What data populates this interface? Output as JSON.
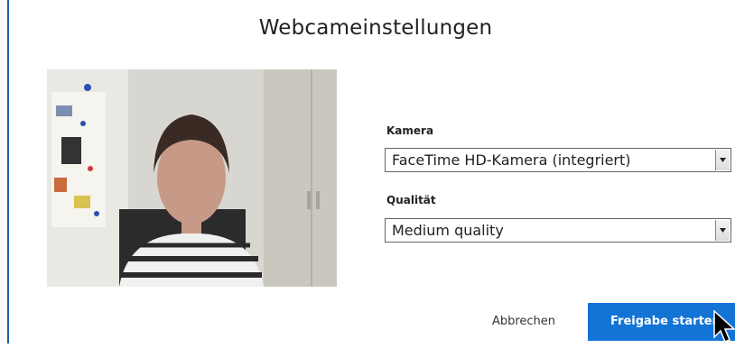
{
  "dialog": {
    "title": "Webcameinstellungen"
  },
  "camera": {
    "label": "Kamera",
    "selected": "FaceTime HD-Kamera (integriert)"
  },
  "quality": {
    "label": "Qualität",
    "selected": "Medium quality"
  },
  "buttons": {
    "cancel": "Abbrechen",
    "start": "Freigabe starten"
  },
  "colors": {
    "accent": "#1474d6",
    "border": "#1f5fa8"
  },
  "icons": {
    "select_arrow": "chevron-down-icon",
    "cursor": "mouse-pointer-icon"
  }
}
